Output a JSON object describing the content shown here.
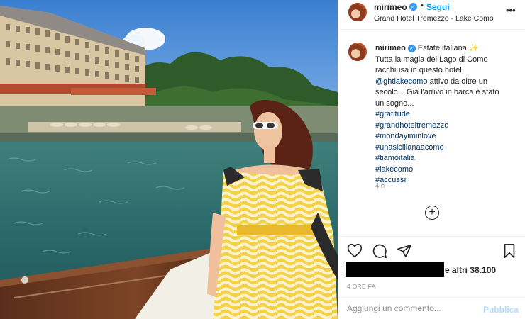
{
  "post": {
    "username": "mirimeo",
    "verified": true,
    "follow_label": "Segui",
    "separator": "•",
    "location": "Grand Hotel Tremezzo - Lake Como",
    "more_icon": "more-horizontal-icon"
  },
  "caption": {
    "username": "mirimeo",
    "first_line": "Estate italiana ✨",
    "line2": "Tutta la magia del Lago di Como",
    "line3": "racchiusa in questo hotel",
    "mention": "@ghtlakecomo",
    "line4_rest": " attivo da oltre un",
    "line5": "secolo... Già l'arrivo in barca è stato",
    "line6": "un sogno...",
    "hashtags": [
      "#gratitude",
      "#grandhoteltremezzo",
      "#mondayiminlove",
      "#unasicilianaacomo",
      "#tiamoitalia",
      "#lakecomo",
      "#accussì"
    ],
    "time_ago": "4 h"
  },
  "load_more_icon": "plus-circle-icon",
  "actions": {
    "icons": [
      "heart-icon",
      "comment-icon",
      "share-icon",
      "bookmark-icon"
    ]
  },
  "likes": {
    "text": "e altri 38.100"
  },
  "timestamp": "4 ORE FA",
  "comment_box": {
    "placeholder": "Aggiungi un commento...",
    "publish_label": "Pubblica"
  },
  "colors": {
    "accent": "#0095f6",
    "verified": "#3897f0",
    "hashtag": "#00376b",
    "muted": "#8e8e8e",
    "publish_disabled": "#b3dbff"
  }
}
